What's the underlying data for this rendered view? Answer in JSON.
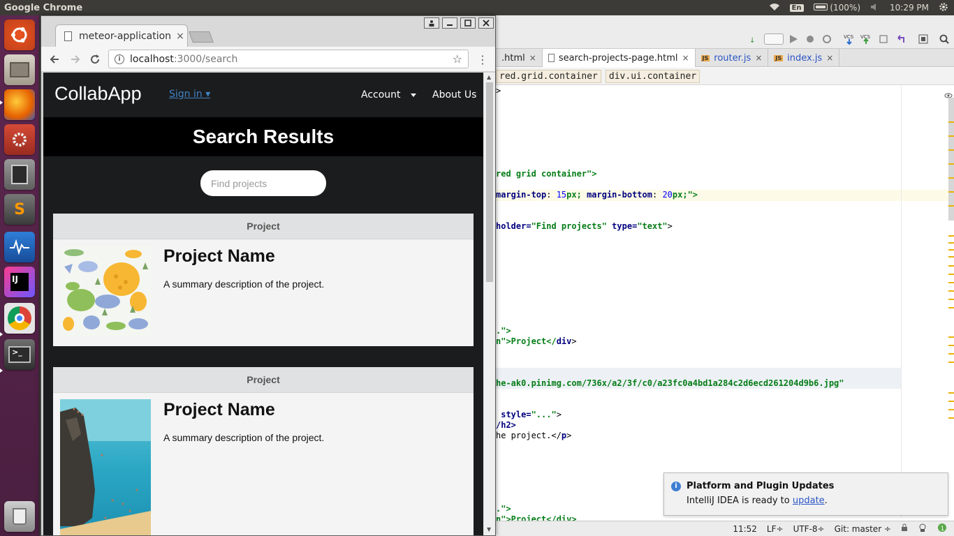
{
  "topbar": {
    "app_title": "Google Chrome",
    "language": "En",
    "battery": "(100%)",
    "time": "10:29 PM"
  },
  "launcher": {
    "items": [
      "ubuntu-dash",
      "files",
      "firefox",
      "system-settings",
      "calculator",
      "sublime-text",
      "system-monitor",
      "intellij-idea",
      "chrome",
      "terminal",
      "trash"
    ]
  },
  "chrome": {
    "tab_title": "meteor-application",
    "tab_close": "×",
    "url_host": "localhost",
    "url_path": ":3000/search"
  },
  "page": {
    "brand": "CollabApp",
    "signin": "Sign in ▾",
    "nav_account": "Account",
    "nav_about": "About Us",
    "banner": "Search Results",
    "search_placeholder": "Find projects",
    "cards": [
      {
        "header": "Project",
        "title": "Project Name",
        "desc": "A summary description of the project."
      },
      {
        "header": "Project",
        "title": "Project Name",
        "desc": "A summary description of the project."
      }
    ]
  },
  "ide": {
    "tabs": [
      {
        "label": ".html"
      },
      {
        "label": "search-projects-page.html"
      },
      {
        "label": "router.js"
      },
      {
        "label": "index.js"
      }
    ],
    "tab_close": "×",
    "breadcrumbs": [
      "red.grid.container",
      "div.ui.container"
    ],
    "code": {
      "l1": ">",
      "l2a": "red grid container",
      "l2b": "\">",
      "l3a": "margin-top",
      "l3b": ": ",
      "l3c": "15",
      "l3d": "px; ",
      "l3e": "margin-bottom",
      "l3f": ": ",
      "l3g": "20",
      "l3h": "px;\">",
      "l4a": "holder=",
      "l4b": "\"Find projects\"",
      "l4c": " type=",
      "l4d": "\"text\"",
      "l4e": ">",
      "l5": ".\">",
      "l6a": "n\">Project</",
      "l6b": "div",
      "l6c": ">",
      "l7": "he-ak0.pinimg.com/736x/a2/3f/c0/a23fc0a4bd1a284c2d6ecd261204d9b6.jpg\"",
      "l8a": " style=",
      "l8b": "\"...\"",
      "l8c": ">",
      "l9": "/h2>",
      "l10a": "he project.</",
      "l10b": "p",
      "l10c": ">",
      "l11": ".\">",
      "l12": "n\">Project</div>"
    },
    "status": {
      "position": "11:52",
      "line_sep": "LF÷",
      "encoding": "UTF-8÷",
      "vcs": "Git: master ÷"
    },
    "notification": {
      "title": "Platform and Plugin Updates",
      "body": "IntelliJ IDEA is ready to ",
      "link": "update",
      "tail": "."
    }
  }
}
